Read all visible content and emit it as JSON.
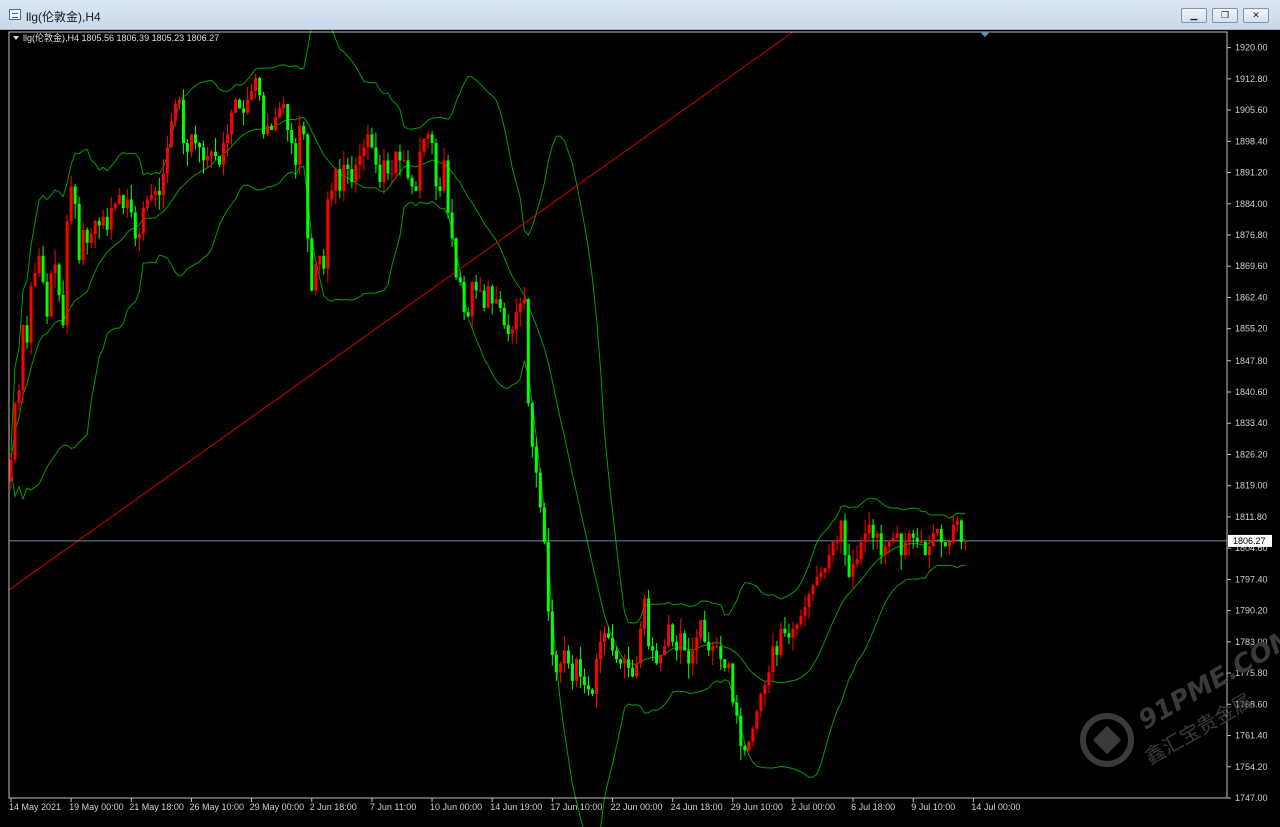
{
  "window": {
    "title": "llg(伦敦金),H4",
    "buttons": {
      "minimize": "▁",
      "restore": "❐",
      "close": "✕"
    }
  },
  "colors": {
    "background": "#000000",
    "axis": "#c0c0c0",
    "bull": "#ff0000",
    "bear": "#00ff00",
    "band": "#00a000",
    "trendline": "#d00000",
    "price_line": "#6e8ca8"
  },
  "watermark": {
    "text": "91PME.COM",
    "subtext": "鑫汇宝贵金属"
  },
  "chart_data": {
    "type": "candlestick",
    "symbol": "llg(伦敦金),H4",
    "ohlc": {
      "open": "1805.56",
      "high": "1806.39",
      "low": "1805.23",
      "close": "1806.27"
    },
    "current_price": "1806.27",
    "ylim": [
      1747.0,
      1923.6
    ],
    "y_ticks": [
      "1920.00",
      "1912.80",
      "1905.60",
      "1898.40",
      "1891.20",
      "1884.00",
      "1876.80",
      "1869.60",
      "1862.40",
      "1855.20",
      "1847.80",
      "1840.60",
      "1833.40",
      "1826.20",
      "1819.00",
      "1811.80",
      "1804.60",
      "1797.40",
      "1790.20",
      "1783.00",
      "1775.80",
      "1768.60",
      "1761.40",
      "1754.20",
      "1747.00"
    ],
    "x_ticks": [
      "14 May 2021",
      "19 May 00:00",
      "21 May 18:00",
      "26 May 10:00",
      "29 May 00:00",
      "2 Jun 18:00",
      "7 Jun 11:00",
      "10 Jun 00:00",
      "14 Jun 19:00",
      "17 Jun 10:00",
      "22 Jun 00:00",
      "24 Jun 18:00",
      "29 Jun 10:00",
      "2 Jul 00:00",
      "6 Jul 18:00",
      "9 Jul 10:00",
      "14 Jul 00:00"
    ],
    "x_tick_bar_index": [
      0,
      15,
      30,
      45,
      60,
      75,
      90,
      105,
      120,
      135,
      150,
      165,
      180,
      195,
      210,
      225,
      240
    ],
    "closes": [
      1825,
      1838,
      1841,
      1856,
      1852,
      1865,
      1868,
      1872,
      1866,
      1858,
      1868,
      1870,
      1863,
      1856,
      1880,
      1888,
      1884,
      1871,
      1878,
      1875,
      1877,
      1880,
      1879,
      1881,
      1878,
      1883,
      1884,
      1886,
      1883,
      1885,
      1882,
      1876,
      1877,
      1883,
      1885,
      1886,
      1887,
      1886,
      1891,
      1897,
      1903,
      1907,
      1908,
      1898,
      1896,
      1900,
      1898,
      1897,
      1894,
      1895,
      1896,
      1895,
      1893,
      1898,
      1900,
      1905,
      1908,
      1906,
      1905,
      1908,
      1910,
      1913,
      1909,
      1900,
      1902,
      1901,
      1904,
      1906,
      1907,
      1901,
      1898,
      1893,
      1902,
      1900,
      1876,
      1864,
      1870,
      1872,
      1869,
      1885,
      1887,
      1892,
      1887,
      1893,
      1892,
      1889,
      1893,
      1895,
      1897,
      1900,
      1897,
      1893,
      1889,
      1894,
      1891,
      1891,
      1896,
      1894,
      1894,
      1890,
      1888,
      1887,
      1896,
      1899,
      1900,
      1898,
      1888,
      1887,
      1894,
      1882,
      1876,
      1867,
      1866,
      1859,
      1858,
      1866,
      1864,
      1864,
      1860,
      1865,
      1861,
      1862,
      1860,
      1856,
      1854,
      1855,
      1859,
      1861,
      1862,
      1838,
      1828,
      1822,
      1814,
      1806,
      1790,
      1780,
      1776,
      1778,
      1781,
      1778,
      1774,
      1779,
      1775,
      1773,
      1772,
      1771,
      1779,
      1783,
      1785,
      1784,
      1781,
      1779,
      1778,
      1779,
      1777,
      1775,
      1778,
      1786,
      1793,
      1782,
      1781,
      1778,
      1780,
      1782,
      1787,
      1783,
      1781,
      1785,
      1781,
      1778,
      1781,
      1784,
      1788,
      1783,
      1781,
      1782,
      1782,
      1779,
      1777,
      1778,
      1769,
      1766,
      1759,
      1758,
      1760,
      1763,
      1767,
      1771,
      1773,
      1776,
      1782,
      1780,
      1786,
      1785,
      1784,
      1786,
      1787,
      1789,
      1791,
      1794,
      1796,
      1798,
      1799,
      1800,
      1803,
      1806,
      1806,
      1811,
      1803,
      1798,
      1801,
      1802,
      1806,
      1808,
      1810,
      1807,
      1808,
      1803,
      1805,
      1806,
      1807,
      1808,
      1803,
      1806,
      1808,
      1807,
      1806,
      1806,
      1803,
      1805,
      1808,
      1809,
      1806,
      1805,
      1806,
      1810,
      1811,
      1806,
      1806.27
    ]
  }
}
